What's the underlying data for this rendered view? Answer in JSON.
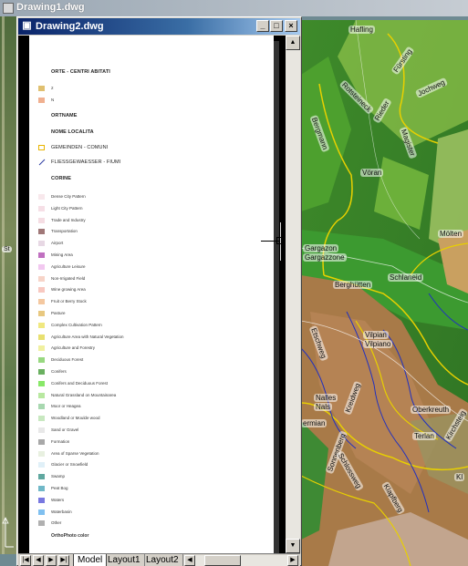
{
  "back_window": {
    "title": "Drawing1.dwg"
  },
  "front_window": {
    "title": "Drawing2.dwg",
    "buttons": {
      "minimize": "_",
      "maximize": "□",
      "close": "×"
    }
  },
  "legend": {
    "section1_title": "ORTE - CENTRI ABITATI",
    "section1_items": [
      {
        "label": "2",
        "color": "#e0c070"
      },
      {
        "label": "N",
        "color": "#f0b090"
      }
    ],
    "section2_title": "ORTNAME",
    "section3_title": "NOME LOCALITA",
    "gemeinden": {
      "label": "GEMEINDEN - COMUNI",
      "color": "#e8b400"
    },
    "fliess": {
      "label": "FLIESSGEWAESSER - FIUMI",
      "color": "#2a3aa0"
    },
    "corine_title": "CORINE",
    "corine_items": [
      {
        "label": "Dense City Pattern",
        "color": "#f8e8ec"
      },
      {
        "label": "Light City Pattern",
        "color": "#f6dfe6"
      },
      {
        "label": "Trade and Industry",
        "color": "#f5dde3"
      },
      {
        "label": "Transportation",
        "color": "#a07878"
      },
      {
        "label": "Airport",
        "color": "#e7d8e4"
      },
      {
        "label": "Mining Area",
        "color": "#c070c0"
      },
      {
        "label": "Agriculture Leisure",
        "color": "#f2c8f0"
      },
      {
        "label": "Non-Irrigated Field",
        "color": "#f7d4c8"
      },
      {
        "label": "Wine growing Area",
        "color": "#f8c8c0"
      },
      {
        "label": "Fruit or Berry Stock",
        "color": "#f4c8a0"
      },
      {
        "label": "Pasture",
        "color": "#e8c880"
      },
      {
        "label": "Complex Cultivation Pattern",
        "color": "#f0e880"
      },
      {
        "label": "Agriculture Area with Natural Vegetation",
        "color": "#e8e070"
      },
      {
        "label": "Agriculture and Forestry",
        "color": "#f0f0a0"
      },
      {
        "label": "Deciduous Forest",
        "color": "#98d880"
      },
      {
        "label": "Conifers",
        "color": "#6ab060"
      },
      {
        "label": "Conifers and Deciduous Forest",
        "color": "#88e868"
      },
      {
        "label": "Natural Grassland on Mountainarea",
        "color": "#b8e8a0"
      },
      {
        "label": "Moor or Heagea",
        "color": "#a8d8b0"
      },
      {
        "label": "Woodland or Moulde wood",
        "color": "#c8e8c0"
      },
      {
        "label": "Sand or Gravel",
        "color": "#e8e8e8"
      },
      {
        "label": "Formation",
        "color": "#a8a8a8"
      },
      {
        "label": "Area of Sparse Vegetation",
        "color": "#e8f0e0"
      },
      {
        "label": "Glacier or Snowfield",
        "color": "#e0f0f8"
      },
      {
        "label": "Swamp",
        "color": "#60a8a0"
      },
      {
        "label": "Peat Bog",
        "color": "#70b8c8"
      },
      {
        "label": "Waters",
        "color": "#7878e0"
      },
      {
        "label": "Waterbasin",
        "color": "#80c0f0"
      },
      {
        "label": "Other",
        "color": "#b0b0b0"
      }
    ],
    "footer": "OrthoPhoto color"
  },
  "layout_tabs": [
    "Model",
    "Layout1",
    "Layout2"
  ],
  "map_labels": {
    "hafling": "Hafling",
    "voran": "Vöran",
    "gargazon": "Gargazon",
    "gargazzone": "Gargazzone",
    "molten": "Mölten",
    "schlaneid": "Schlaneid",
    "berghuetten": "Berghütten",
    "vilpian": "Vilpian",
    "vilpiano": "Vilpiano",
    "nalles": "Nalles",
    "nals": "Nals",
    "oberkreuth": "Oberkreuth",
    "terlan": "Terlan",
    "ermian": "ermian",
    "kl": "Kl",
    "st": "St",
    "fursting": "Fürsting",
    "rotsteineck": "Rotsteineck",
    "jochweg": "Jochweg",
    "rieder": "Rieder",
    "magister": "Magister",
    "bergmann": "Bergmann",
    "kreidweg": "Kreidweg",
    "schlossweg": "Schlossweg",
    "klapfberg": "Klapfberg",
    "kirchsteig": "Kirchsteig",
    "sonnenberg": "Sonnenberg",
    "etschweg": "Etschweg"
  }
}
